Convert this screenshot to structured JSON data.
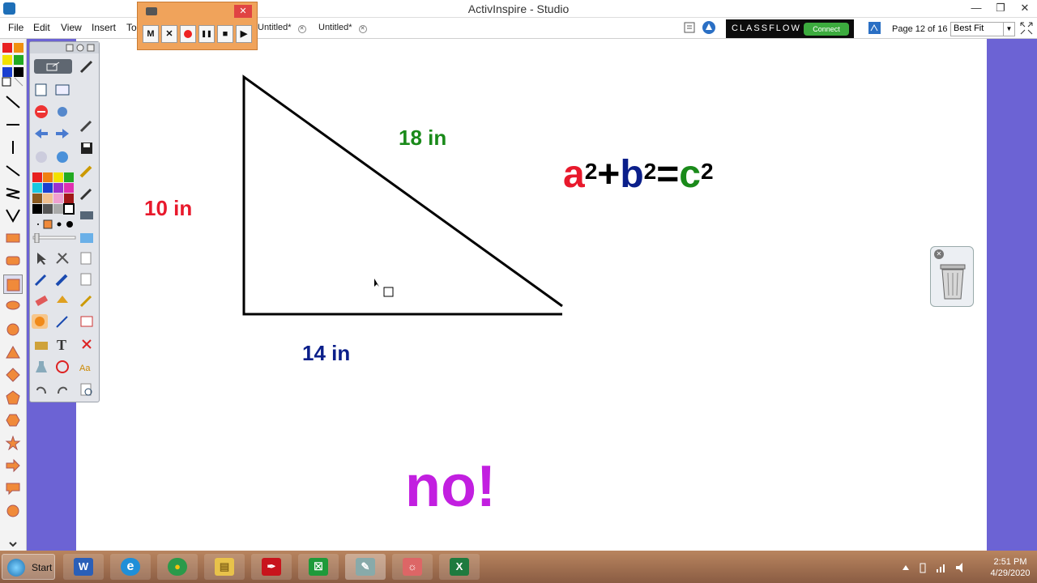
{
  "window": {
    "title": "ActivInspire - Studio",
    "controls": [
      "—",
      "❐",
      "✕"
    ]
  },
  "menu": {
    "items": [
      "File",
      "Edit",
      "View",
      "Insert",
      "To"
    ]
  },
  "tabs": [
    {
      "label": "Untitled*"
    },
    {
      "label": "Untitled*"
    }
  ],
  "recorder": {
    "buttons": [
      "M",
      "✕",
      "",
      "❚❚",
      "■",
      "▶"
    ]
  },
  "classflow": {
    "brand": "CLASSFLOW",
    "connect": "Connect"
  },
  "page": {
    "label": "Page 12 of 16",
    "zoom": "Best Fit"
  },
  "colors": {
    "red": "#e8192c",
    "green": "#1a8a1a",
    "blue": "#0b1f8a",
    "purple": "#c21fe0",
    "canvas_border": "#6c63d4"
  },
  "canvas": {
    "hyp_label": "18 in",
    "left_label": "10 in",
    "bottom_label": "14 in",
    "formula": {
      "a": "a",
      "b": "b",
      "c": "c",
      "exp": "2",
      "plus": "+",
      "eq": "="
    },
    "answer": "no!"
  },
  "taskbar": {
    "start": "Start",
    "apps": [
      "W",
      "e",
      "●",
      "▤",
      "✒",
      "☒",
      "✎",
      "☼",
      "X"
    ],
    "time": "2:51 PM",
    "date": "4/29/2020"
  }
}
